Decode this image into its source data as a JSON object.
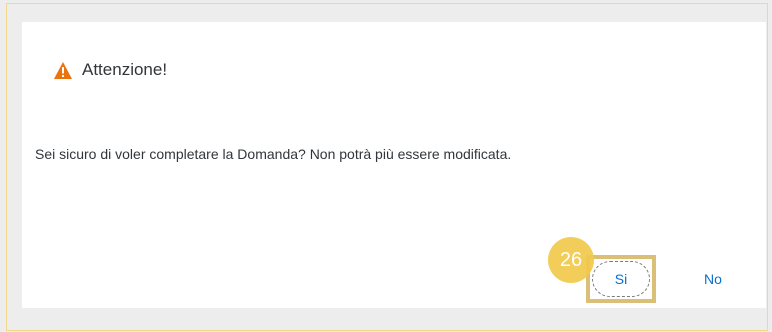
{
  "dialog": {
    "title": "Attenzione!",
    "message": "Sei sicuro di voler completare la Domanda? Non potrà più essere modificata.",
    "icon": "warning-icon",
    "icon_color": "#e9730c"
  },
  "buttons": {
    "yes_label": "Si",
    "no_label": "No"
  },
  "annotation": {
    "step_number": "26",
    "badge_color": "#f2c94c",
    "highlight_color": "#dcbf77"
  }
}
